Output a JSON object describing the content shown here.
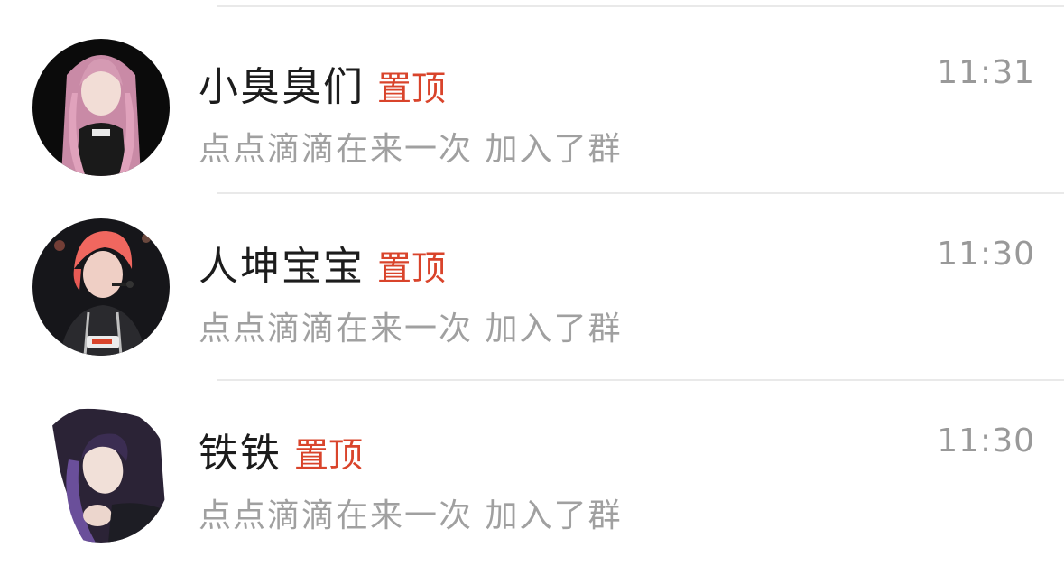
{
  "chats": [
    {
      "name": "小臭臭们",
      "pin_label": "置顶",
      "time": "11:31",
      "preview": "点点滴滴在来一次 加入了群",
      "avatar_icon": "avatar-pink-hair-portrait"
    },
    {
      "name": "人坤宝宝",
      "pin_label": "置顶",
      "time": "11:30",
      "preview": "点点滴滴在来一次 加入了群",
      "avatar_icon": "avatar-red-hair-portrait"
    },
    {
      "name": "铁铁",
      "pin_label": "置顶",
      "time": "11:30",
      "preview": "点点滴滴在来一次 加入了群",
      "avatar_icon": "avatar-purple-hair-portrait"
    }
  ],
  "colors": {
    "pin": "#d9442b",
    "name": "#1c1c1c",
    "secondary": "#a0a0a0",
    "divider": "#e9e9e9"
  }
}
